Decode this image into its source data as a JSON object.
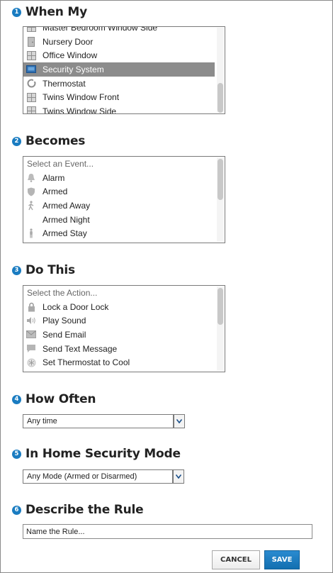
{
  "sections": {
    "when_my": {
      "step": "1",
      "title": "When My"
    },
    "becomes": {
      "step": "2",
      "title": "Becomes"
    },
    "do_this": {
      "step": "3",
      "title": "Do This"
    },
    "how_often": {
      "step": "4",
      "title": "How Often"
    },
    "security_mode": {
      "step": "5",
      "title": "In Home Security Mode"
    },
    "describe": {
      "step": "6",
      "title": "Describe the Rule"
    }
  },
  "devices": {
    "items": [
      {
        "label": "Master Bedroom Window Side",
        "icon": "window-icon"
      },
      {
        "label": "Nursery Door",
        "icon": "door-icon"
      },
      {
        "label": "Office Window",
        "icon": "window-icon"
      },
      {
        "label": "Security System",
        "icon": "security-panel-icon",
        "selected": true
      },
      {
        "label": "Thermostat",
        "icon": "thermostat-icon"
      },
      {
        "label": "Twins Window Front",
        "icon": "window-icon"
      },
      {
        "label": "Twins Window Side",
        "icon": "window-icon"
      }
    ]
  },
  "events": {
    "placeholder": "Select an Event...",
    "items": [
      {
        "label": "Alarm",
        "icon": "bell-icon"
      },
      {
        "label": "Armed",
        "icon": "shield-icon"
      },
      {
        "label": "Armed Away",
        "icon": "walking-person-icon"
      },
      {
        "label": "Armed Night",
        "icon": "moon-icon"
      },
      {
        "label": "Armed Stay",
        "icon": "standing-person-icon"
      }
    ]
  },
  "actions": {
    "placeholder": "Select the Action...",
    "items": [
      {
        "label": "Lock a Door Lock",
        "icon": "lock-icon"
      },
      {
        "label": "Play Sound",
        "icon": "speaker-icon"
      },
      {
        "label": "Send Email",
        "icon": "envelope-icon"
      },
      {
        "label": "Send Text Message",
        "icon": "speech-bubble-icon"
      },
      {
        "label": "Set Thermostat to Cool",
        "icon": "snowflake-icon"
      }
    ]
  },
  "how_often": {
    "value": "Any time"
  },
  "security_mode": {
    "value": "Any Mode (Armed or Disarmed)"
  },
  "rule_name": {
    "placeholder": "Name the Rule...",
    "value": ""
  },
  "buttons": {
    "cancel": "CANCEL",
    "save": "SAVE"
  },
  "colors": {
    "accent": "#1a7cc1",
    "selected_row": "#8c8c8c",
    "save_button": "#1a7cc1"
  }
}
